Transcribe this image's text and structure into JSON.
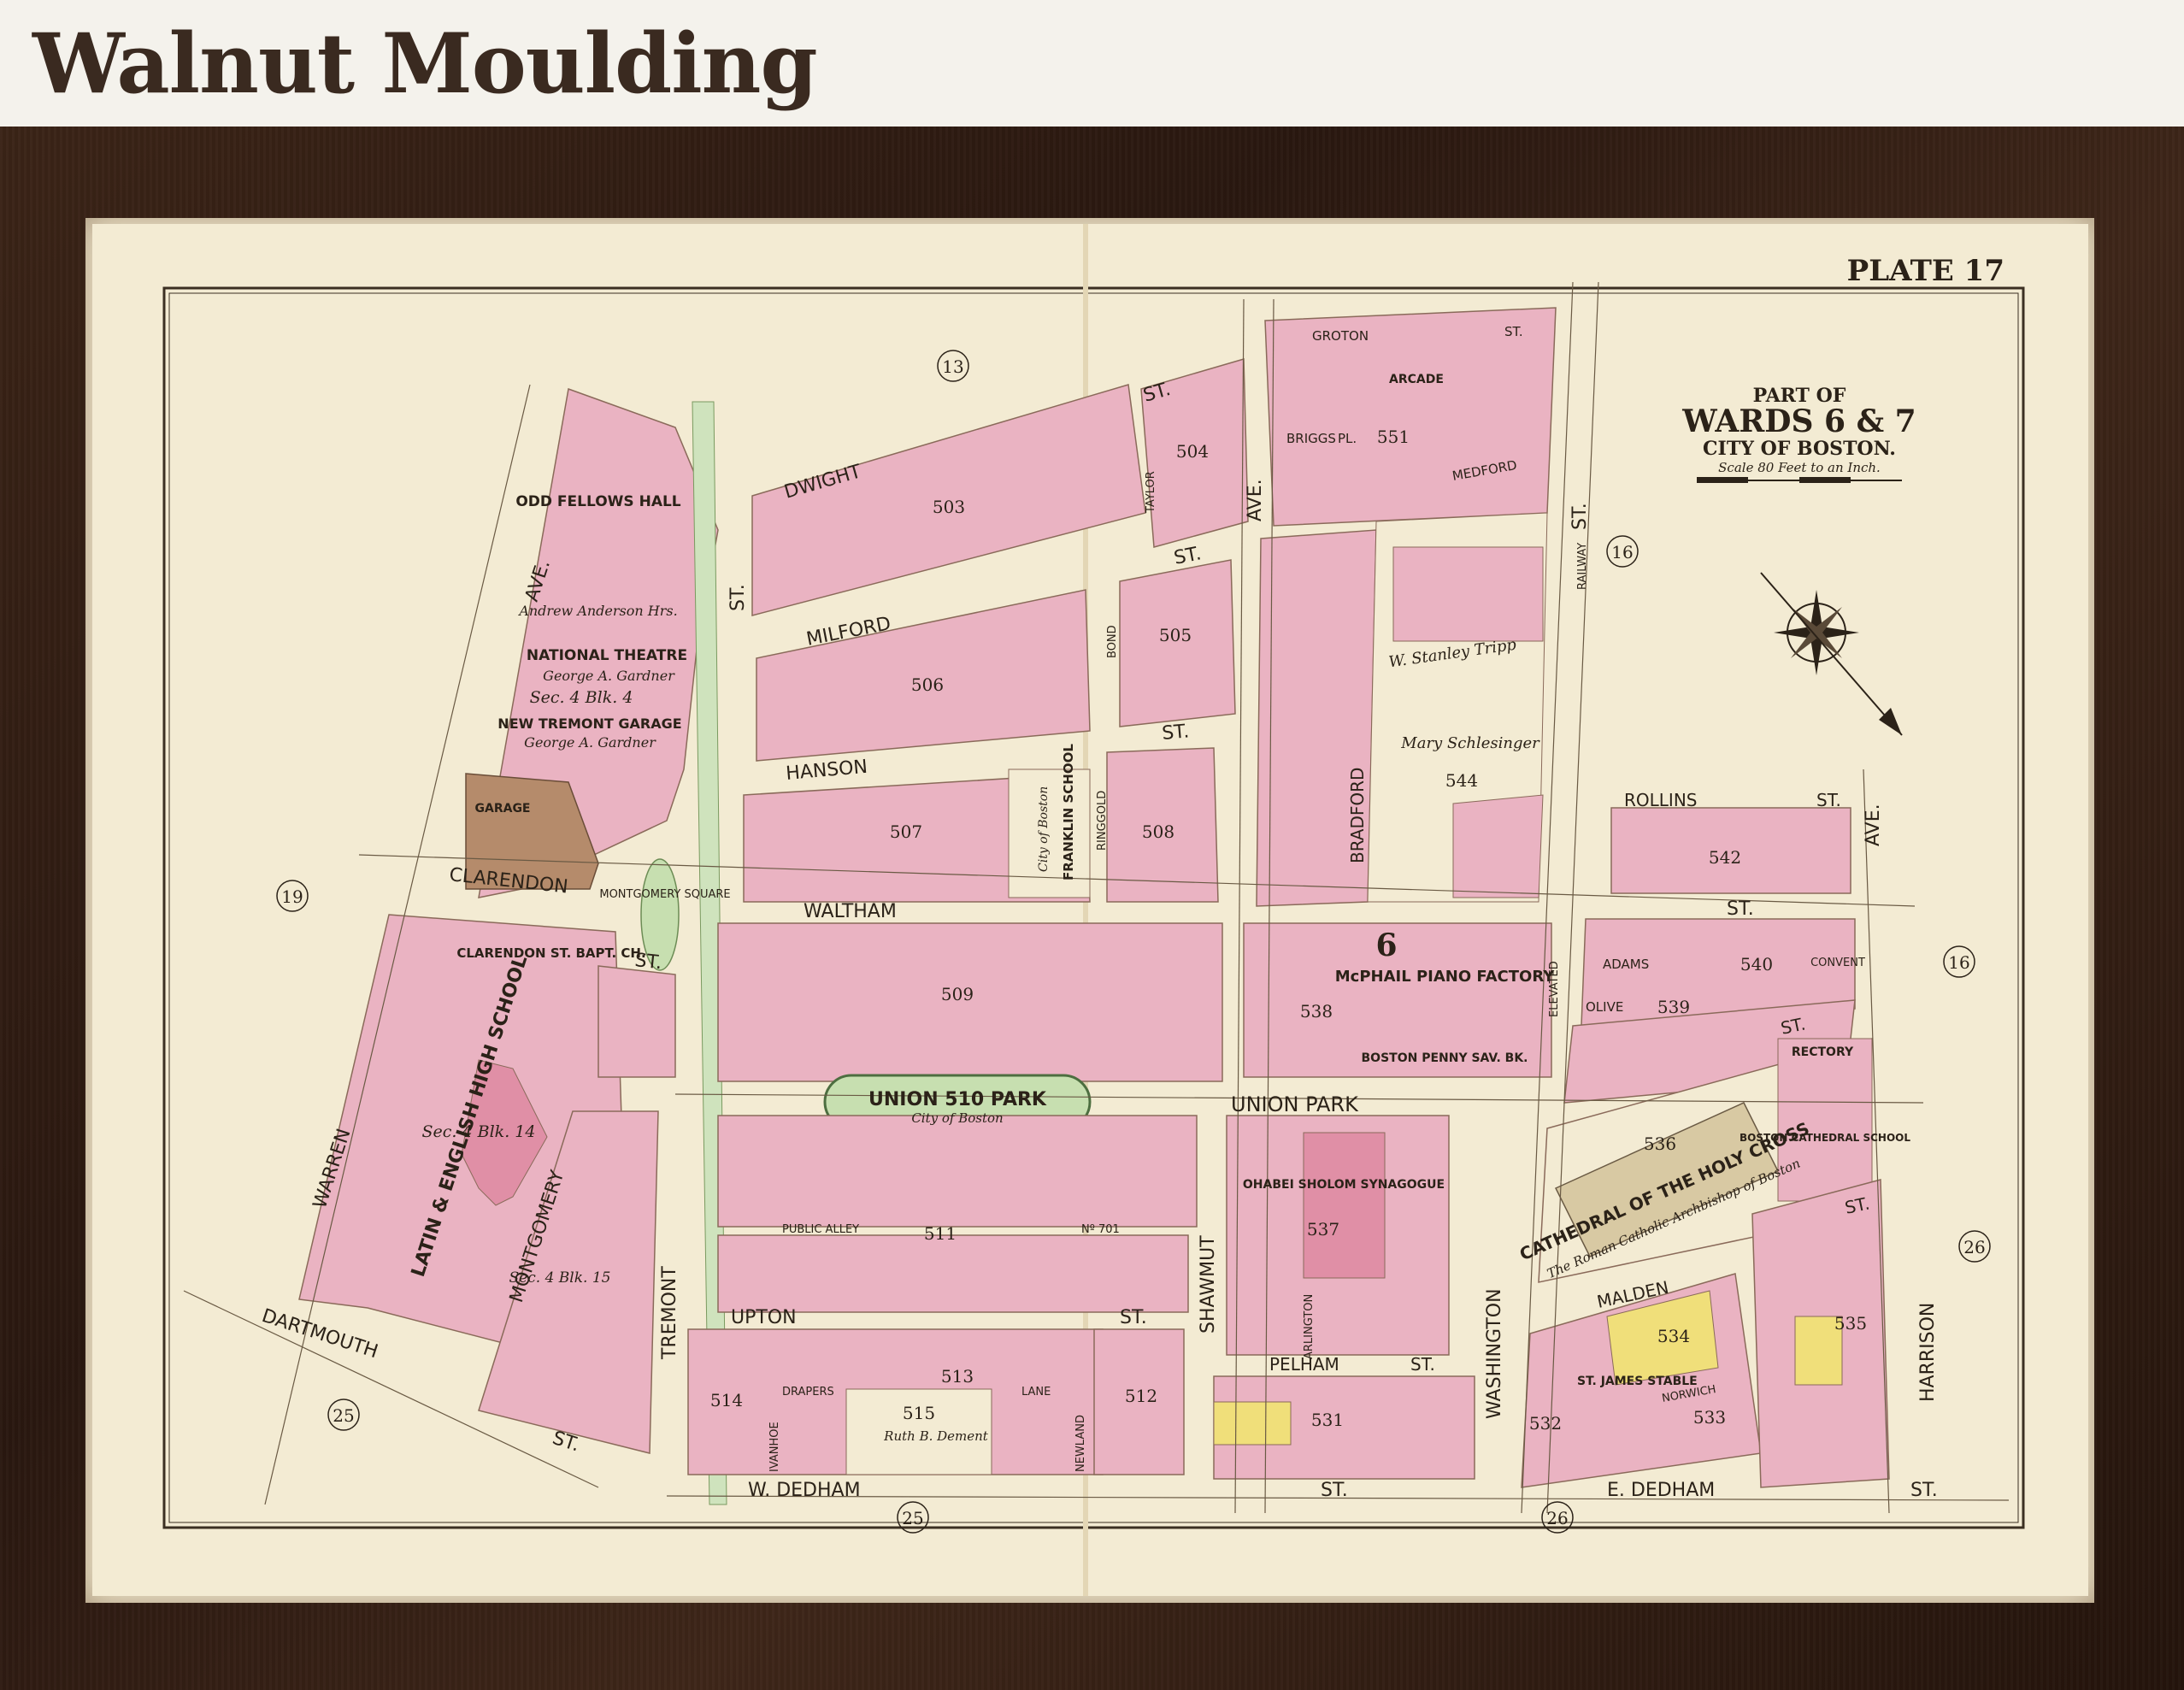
{
  "header": {
    "title": "Walnut Moulding"
  },
  "map": {
    "plate": "PLATE 17",
    "title": {
      "line1": "PART OF",
      "line2": "WARDS 6 & 7",
      "line3": "CITY OF BOSTON.",
      "scale": "Scale 80 Feet to an Inch."
    },
    "colors": {
      "paper": "#f3ebd3",
      "lot_pink": "#eab3c2",
      "lot_yellow": "#f0df7a",
      "lot_green": "#c7dfb0",
      "street": "#f3ebd3",
      "ink": "#2b2218",
      "frame": "#2e1b11"
    },
    "ward_numbers": {
      "w13": "13",
      "w16a": "16",
      "w16b": "16",
      "w19": "19",
      "w25a": "25",
      "w25b": "25",
      "w26a": "26",
      "w26b": "26"
    },
    "streets": {
      "groton": "GROTON",
      "dwight": "DWIGHT",
      "st_dwight": "ST.",
      "milford": "MILFORD",
      "st_milford": "ST.",
      "hanson": "HANSON",
      "st_hanson": "ST.",
      "waltham": "WALTHAM",
      "st_waltham": "ST.",
      "clarendon": "CLARENDON",
      "st_clarendon": "ST.",
      "union_park": "UNION PARK",
      "upton": "UPTON",
      "st_upton": "ST.",
      "w_dedham": "W. DEDHAM",
      "st_w_dedham": "ST.",
      "e_dedham": "E. DEDHAM",
      "st_e_dedham": "ST.",
      "dartmouth": "DARTMOUTH",
      "st_dartmouth": "ST.",
      "warren": "WARREN",
      "ave_warren": "AVE.",
      "montgomery": "MONTGOMERY",
      "tremont": "TREMONT",
      "shawmut": "SHAWMUT",
      "ave_shawmut": "AVE.",
      "washington": "WASHINGTON",
      "st_washington": "ST.",
      "harrison": "HARRISON",
      "ave_harrison": "AVE.",
      "bradford": "BRADFORD",
      "rollins": "ROLLINS",
      "st_rollins": "ST.",
      "malden": "MALDEN",
      "st_malden": "ST.",
      "pelham": "PELHAM",
      "st_pelham": "ST.",
      "briggs": "BRIGGS",
      "pl_briggs": "PL.",
      "medford": "MEDFORD",
      "adams": "ADAMS",
      "olive": "OLIVE",
      "st_olive": "ST.",
      "public_alley": "PUBLIC ALLEY",
      "no_701": "Nº 701",
      "drapers": "DRAPERS",
      "lane": "LANE",
      "ringgold": "RINGGOLD",
      "bond": "BOND",
      "taylor": "TAYLOR",
      "arlington": "ARLINGTON",
      "norwich": "NORWICH",
      "ivanhoe": "IVANHOE",
      "newland": "NEWLAND",
      "elevated": "ELEVATED",
      "railway": "RAILWAY",
      "st_generic": "ST."
    },
    "landmarks": {
      "odd_fellows": "ODD FELLOWS HALL",
      "national_theatre": "NATIONAL THEATRE",
      "gardner_1": "George A. Gardner",
      "tremont_garage": "NEW TREMONT GARAGE",
      "gardner_2": "George A. Gardner",
      "garage": "GARAGE",
      "montgomery_square": "MONTGOMERY SQUARE",
      "clarendon_bapt": "CLARENDON ST. BAPT. CH.",
      "latin_english": "LATIN & ENGLISH HIGH SCHOOL",
      "franklin_school": "FRANKLIN SCHOOL",
      "city_of_boston_1": "City of Boston",
      "union_park_label": "UNION 510 PARK",
      "city_of_boston_2": "City of Boston",
      "mcphail": "McPHAIL PIANO FACTORY",
      "boston_penny": "BOSTON PENNY SAV. BK.",
      "ohabei": "OHABEI SHOLOM SYNAGOGUE",
      "cathedral": "CATHEDRAL OF THE HOLY CROSS",
      "archbishop": "The Roman Catholic Archbishop of Boston",
      "rectory": "RECTORY",
      "cathedral_school": "BOSTON CATHEDRAL SCHOOL",
      "convent": "CONVENT",
      "st_james_stable": "ST. JAMES STABLE",
      "stanley_tripp": "W. Stanley Tripp",
      "mary_schlesinger": "Mary Schlesinger",
      "arcade": "ARCADE",
      "sec_4": "Sec. 4 Blk. 4",
      "sec_14": "Sec. 4 Blk. 14",
      "sec_15": "Sec. 4 Blk. 15",
      "andrew_anderson": "Andrew Anderson Hrs.",
      "ruth_dement": "Ruth B. Dement"
    },
    "block_numbers": {
      "b503": "503",
      "b504": "504",
      "b505": "505",
      "b506": "506",
      "b507": "507",
      "b508": "508",
      "b509": "509",
      "b511": "511",
      "b512": "512",
      "b513": "513",
      "b514": "514",
      "b515": "515",
      "b531": "531",
      "b532": "532",
      "b533": "533",
      "b534": "534",
      "b535": "535",
      "b536": "536",
      "b537": "537",
      "b538": "538",
      "b539": "539",
      "b540": "540",
      "b542": "542",
      "b544": "544",
      "b551": "551",
      "b6": "6"
    }
  }
}
